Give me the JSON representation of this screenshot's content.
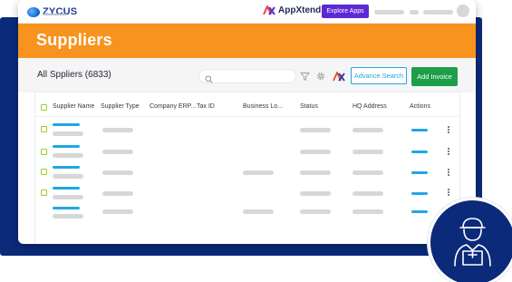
{
  "brand": {
    "logo_text": "ZYCUS",
    "appxtend_text": "AppXtend",
    "explore_label": "Explore Apps"
  },
  "page": {
    "title": "Suppliers",
    "list_title": "All Sppliers (6833)"
  },
  "search": {
    "placeholder": ""
  },
  "toolbar": {
    "advanced_search_label": "Advance Search",
    "add_invoice_label": "Add Invoice"
  },
  "table": {
    "columns": [
      "Supplier Name",
      "Supplier Type",
      "Company ERP...",
      "Tax ID",
      "Business Lo...",
      "Status",
      "HQ Address",
      "Actions"
    ]
  },
  "icons": {
    "logo": "zycus-logo-icon",
    "appxtend": "appxtend-icon",
    "search": "search-icon",
    "filter": "filter-icon",
    "settings": "gear-icon",
    "appxtend_tool": "appxtend-tool-icon",
    "more": "kebab-menu-icon",
    "badge": "delivery-person-icon"
  },
  "colors": {
    "header_orange": "#f7931e",
    "navy": "#0b2a7a",
    "explore_purple": "#5b2ad4",
    "add_green": "#1e9e4a",
    "accent_blue": "#20a7d8",
    "checkbox_green": "#9acd32"
  }
}
